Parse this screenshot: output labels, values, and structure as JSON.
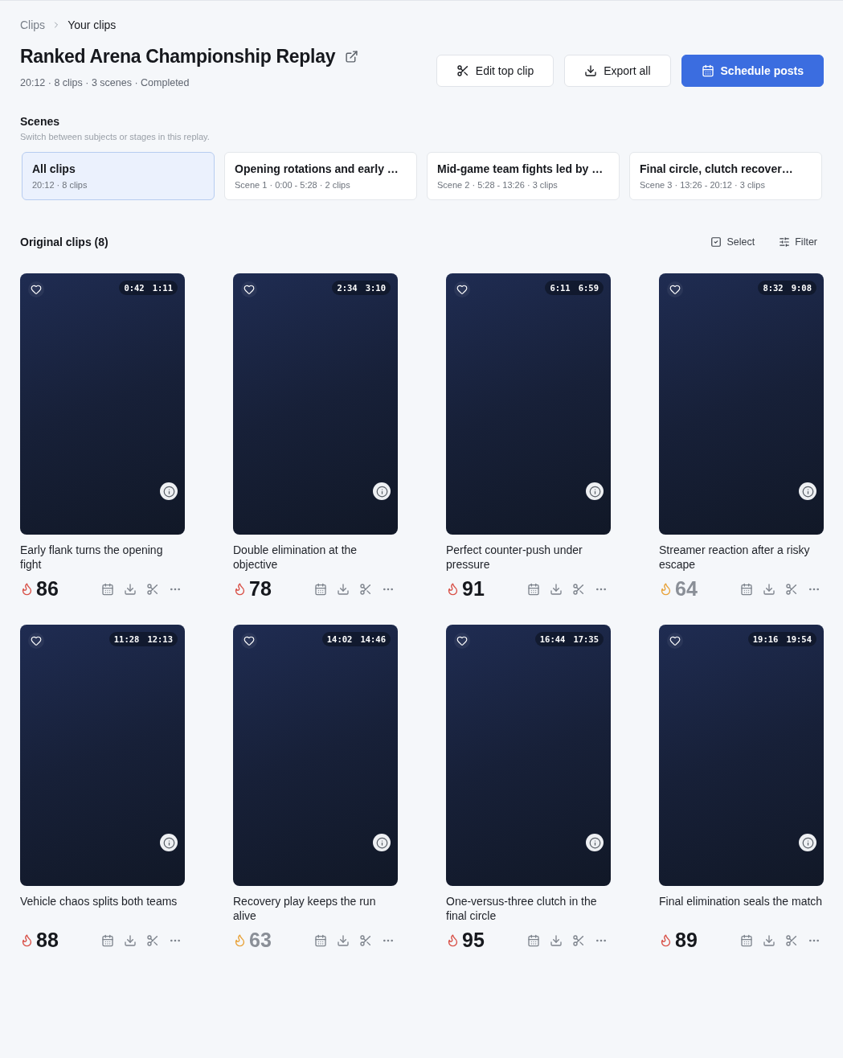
{
  "breadcrumb": [
    {
      "label": "Clips",
      "current": false
    },
    {
      "label": "Your clips",
      "current": true
    }
  ],
  "header": {
    "title": "Ranked Arena Championship Replay",
    "meta": "20:12 · 8 clips · 3 scenes · Completed"
  },
  "actions": [
    {
      "label": "Edit top clip",
      "kind": "scissors",
      "primary": false
    },
    {
      "label": "Export all",
      "kind": "download",
      "primary": false
    },
    {
      "label": "Schedule posts",
      "kind": "calendar",
      "primary": true
    }
  ],
  "scenes": {
    "title": "Scenes",
    "subtitle": "Switch between subjects or stages in this replay.",
    "items": [
      {
        "label": "All clips",
        "meta": "20:12 · 8 clips",
        "selected": true
      },
      {
        "label": "Opening rotations and early …",
        "meta": "Scene 1 · 0:00 - 5:28 · 2 clips",
        "selected": false
      },
      {
        "label": "Mid-game team fights led by …",
        "meta": "Scene 2 · 5:28 - 13:26 · 3 clips",
        "selected": false
      },
      {
        "label": "Final circle, clutch recover…",
        "meta": "Scene 3 · 13:26 - 20:12 · 3 clips",
        "selected": false
      }
    ]
  },
  "clips_section": {
    "title": "Original clips (8)",
    "tools": [
      {
        "label": "Select",
        "kind": "select"
      },
      {
        "label": "Filter",
        "kind": "filter"
      }
    ]
  },
  "clips": [
    {
      "start": "0:42",
      "end": "1:11",
      "title": "Early flank turns the opening fight",
      "score": "86",
      "kind": "high"
    },
    {
      "start": "2:34",
      "end": "3:10",
      "title": "Double elimination at the objective",
      "score": "78",
      "kind": "high"
    },
    {
      "start": "6:11",
      "end": "6:59",
      "title": "Perfect counter-push under pressure",
      "score": "91",
      "kind": "high"
    },
    {
      "start": "8:32",
      "end": "9:08",
      "title": "Streamer reaction after a risky escape",
      "score": "64",
      "kind": "medium"
    },
    {
      "start": "11:28",
      "end": "12:13",
      "title": "Vehicle chaos splits both teams",
      "score": "88",
      "kind": "high"
    },
    {
      "start": "14:02",
      "end": "14:46",
      "title": "Recovery play keeps the run alive",
      "score": "63",
      "kind": "medium"
    },
    {
      "start": "16:44",
      "end": "17:35",
      "title": "One-versus-three clutch in the final circle",
      "score": "95",
      "kind": "high"
    },
    {
      "start": "19:16",
      "end": "19:54",
      "title": "Final elimination seals the match",
      "score": "89",
      "kind": "high"
    }
  ]
}
